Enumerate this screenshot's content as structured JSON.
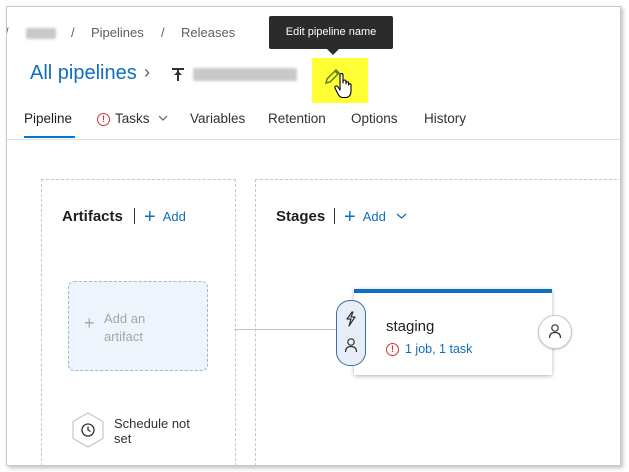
{
  "breadcrumb": {
    "separator": "/",
    "items": [
      "Pipelines",
      "Releases"
    ]
  },
  "tooltip": {
    "text": "Edit pipeline name"
  },
  "header": {
    "all_pipelines_label": "All pipelines",
    "chevron": "›"
  },
  "tabs": [
    {
      "label": "Pipeline",
      "active": true
    },
    {
      "label": "Tasks",
      "has_warning": true,
      "has_dropdown": true
    },
    {
      "label": "Variables"
    },
    {
      "label": "Retention"
    },
    {
      "label": "Options"
    },
    {
      "label": "History"
    }
  ],
  "artifacts": {
    "title": "Artifacts",
    "add_label": "Add",
    "add_artifact_label": "Add an artifact",
    "schedule_label": "Schedule not set"
  },
  "stages": {
    "title": "Stages",
    "add_label": "Add",
    "stage": {
      "name": "staging",
      "summary": "1 job, 1 task"
    }
  },
  "colors": {
    "accent": "#106ebe",
    "highlight": "#ffff33",
    "warning": "#d13438",
    "tooltip_bg": "#2b2b2b"
  },
  "icons": {
    "edit": "pencil-icon",
    "cursor": "hand-cursor-icon",
    "pipeline": "pipeline-icon",
    "trigger": "lightning-icon",
    "approver": "person-icon",
    "schedule": "clock-icon"
  }
}
